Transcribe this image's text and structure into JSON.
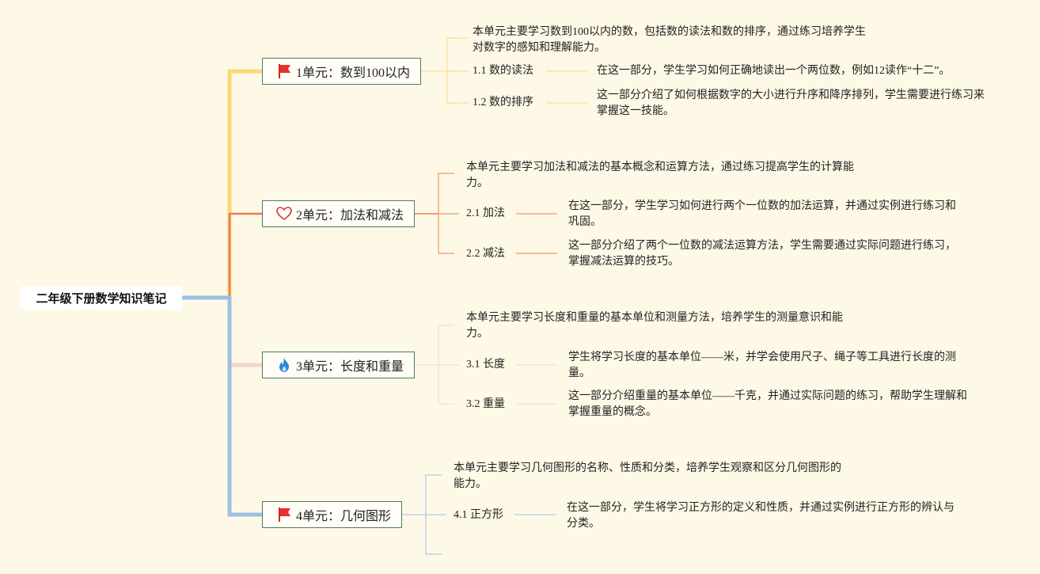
{
  "root": {
    "title": "二年级下册数学知识笔记"
  },
  "units": [
    {
      "title": "1单元：数到100以内",
      "icon": "red-flag-icon",
      "summary": "本单元主要学习数到100以内的数，包括数的读法和数的排序，通过练习培养学生对数字的感知和理解能力。",
      "sections": [
        {
          "label": "1.1 数的读法",
          "detail": "在这一部分，学生学习如何正确地读出一个两位数，例如12读作“十二”。"
        },
        {
          "label": "1.2 数的排序",
          "detail": "这一部分介绍了如何根据数字的大小进行升序和降序排列，学生需要进行练习来掌握这一技能。"
        }
      ]
    },
    {
      "title": "2单元：加法和减法",
      "icon": "heart-outline-icon",
      "summary": "本单元主要学习加法和减法的基本概念和运算方法，通过练习提高学生的计算能力。",
      "sections": [
        {
          "label": "2.1 加法",
          "detail": "在这一部分，学生学习如何进行两个一位数的加法运算，并通过实例进行练习和巩固。"
        },
        {
          "label": "2.2 减法",
          "detail": "这一部分介绍了两个一位数的减法运算方法，学生需要通过实际问题进行练习，掌握减法运算的技巧。"
        }
      ]
    },
    {
      "title": "3单元：长度和重量",
      "icon": "fire-icon",
      "summary": "本单元主要学习长度和重量的基本单位和测量方法，培养学生的测量意识和能力。",
      "sections": [
        {
          "label": "3.1 长度",
          "detail": "学生将学习长度的基本单位——米，并学会使用尺子、绳子等工具进行长度的测量。"
        },
        {
          "label": "3.2 重量",
          "detail": "这一部分介绍重量的基本单位——千克，并通过实际问题的练习，帮助学生理解和掌握重量的概念。"
        }
      ]
    },
    {
      "title": "4单元：几何图形",
      "icon": "red-flag-icon",
      "summary": "本单元主要学习几何图形的名称、性质和分类，培养学生观察和区分几何图形的能力。",
      "sections": [
        {
          "label": "4.1 正方形",
          "detail": "在这一部分，学生将学习正方形的定义和性质，并通过实例进行正方形的辨认与分类。"
        }
      ]
    }
  ],
  "colors": {
    "background": "#fef8e6",
    "branch1": "#f9d877",
    "branch2": "#e8814a",
    "branch3": "#f2d6c8",
    "branch4": "#9dbfe4",
    "node_border": "#4e7a63"
  }
}
